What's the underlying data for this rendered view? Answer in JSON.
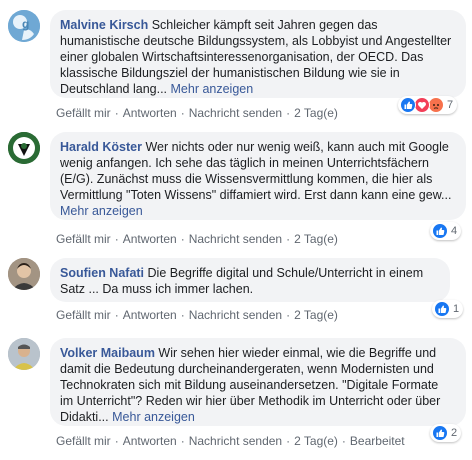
{
  "comments": [
    {
      "author": "Malvine Kirsch",
      "text": "Schleicher kämpft seit Jahren gegen das humanistische deutsche Bildungssystem, als Lobbyist und Angestellter einer globalen Wirtschaftsinteressenorganisation, der OECD. Das klassische Bildungsziel der humanistischen Bildung wie sie in Deutschland lang...",
      "more": "Mehr anzeigen",
      "like": "Gefällt mir",
      "reply": "Antworten",
      "message": "Nachricht senden",
      "time": "2 Tag(e)",
      "reactions": [
        "like-icon",
        "love-icon",
        "angry-icon"
      ],
      "reaction_count": "7"
    },
    {
      "author": "Harald Köster",
      "text": "Wer nichts oder nur wenig weiß, kann auch mit Google wenig anfangen. Ich sehe das täglich in meinen Unterrichtsfächern (E/G). Zunächst muss die Wissensvermittlung kommen, die hier als Vermittlung \"Toten Wissens\" diffamiert wird. Erst dann kann eine gew...",
      "more": "Mehr anzeigen",
      "like": "Gefällt mir",
      "reply": "Antworten",
      "message": "Nachricht senden",
      "time": "2 Tag(e)",
      "reactions": [
        "like-icon"
      ],
      "reaction_count": "4"
    },
    {
      "author": "Soufien Nafati",
      "text": "Die Begriffe digital und Schule/Unterricht in einem Satz ... Da muss ich immer lachen.",
      "like": "Gefällt mir",
      "reply": "Antworten",
      "message": "Nachricht senden",
      "time": "2 Tag(e)",
      "reactions": [
        "like-icon"
      ],
      "reaction_count": "1"
    },
    {
      "author": "Volker Maibaum",
      "text": "Wir sehen hier wieder einmal, wie die Begriffe und damit die Bedeutung durcheinandergeraten, wenn Modernisten und Technokraten sich mit Bildung auseinandersetzen. \"Digitale Formate im Unterricht\"? Reden wir hier über Methodik im Unterricht oder über Didakti...",
      "more": "Mehr anzeigen",
      "like": "Gefällt mir",
      "reply": "Antworten",
      "message": "Nachricht senden",
      "time": "2 Tag(e)",
      "edited": "Bearbeitet",
      "reactions": [
        "like-icon"
      ],
      "reaction_count": "2"
    }
  ],
  "colors": {
    "link": "#385898",
    "bubble": "#f2f3f5",
    "like_blue": "#1877f2",
    "love_red": "#f33e58",
    "angry_orange": "#f7714c"
  }
}
